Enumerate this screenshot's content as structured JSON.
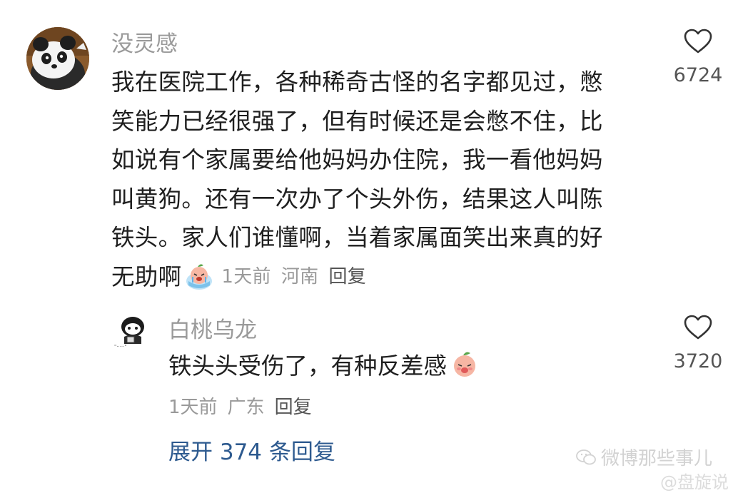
{
  "main_comment": {
    "username": "没灵感",
    "text_lines": [
      "我在医院工作，各种稀奇古怪的名字都见过，憋",
      "笑能力已经很强了，但有时候还是会憋不住，比",
      "如说有个家属要给他妈妈办住院，我一看他妈妈",
      "叫黄狗。还有一次办了个头外伤，结果这人叫陈",
      "铁头。家人们谁懂啊，当着家属面笑出来真的好"
    ],
    "last_line": "无助啊",
    "emoji": "crying-peach-emoji",
    "time": "1天前",
    "location": "河南",
    "reply_label": "回复",
    "likes": "6724",
    "like_icon": "heart-outline-icon"
  },
  "reply_comment": {
    "username": "白桃乌龙",
    "text": "铁头头受伤了，有种反差感",
    "emoji": "peach-tongue-emoji",
    "time": "1天前",
    "location": "广东",
    "reply_label": "回复",
    "likes": "3720",
    "like_icon": "heart-outline-icon"
  },
  "expand_label": "展开 374 条回复",
  "watermark": {
    "text": "微博那些事儿",
    "sub": "@盘旋说"
  },
  "colors": {
    "username": "#9a9a9a",
    "body_text": "#1f1f1f",
    "meta": "#9a9a9a",
    "link": "#2d5a8f"
  }
}
